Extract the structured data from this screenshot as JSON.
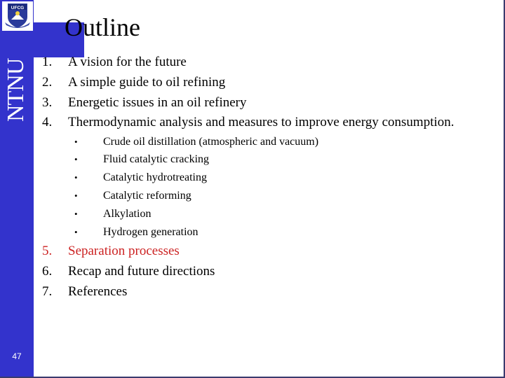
{
  "sidebar": {
    "logo_text": "UFCG",
    "vertical_label": "NTNU",
    "page_number": "47"
  },
  "slide": {
    "title": "Outline",
    "items": [
      {
        "number": "1.",
        "label": "A vision for the future"
      },
      {
        "number": "2.",
        "label": "A simple guide to oil refining"
      },
      {
        "number": "3.",
        "label": "Energetic issues in an oil refinery"
      },
      {
        "number": "4.",
        "label": "Thermodynamic analysis and measures to improve energy consumption."
      },
      {
        "number": "5.",
        "label": "Separation processes"
      },
      {
        "number": "6.",
        "label": "Recap and future directions"
      },
      {
        "number": "7.",
        "label": "References"
      }
    ],
    "subitems": [
      {
        "bullet": "•",
        "label": "Crude oil distillation (atmospheric and vacuum)"
      },
      {
        "bullet": "•",
        "label": "Fluid catalytic cracking"
      },
      {
        "bullet": "•",
        "label": "Catalytic hydrotreating"
      },
      {
        "bullet": "•",
        "label": "Catalytic reforming"
      },
      {
        "bullet": "•",
        "label": "Alkylation"
      },
      {
        "bullet": "•",
        "label": "Hydrogen generation"
      }
    ],
    "highlight_color": "#cc2222",
    "brand_color": "#3333cc"
  }
}
